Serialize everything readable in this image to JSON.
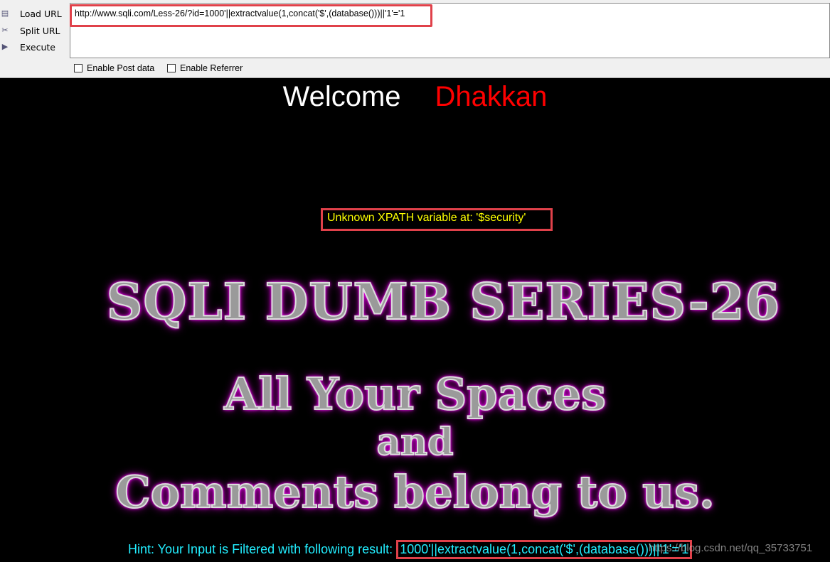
{
  "toolbar": {
    "load_url": "Load URL",
    "split_url": "Split URL",
    "execute": "Execute",
    "url_value": "http://www.sqli.com/Less-26/?id=1000'||extractvalue(1,concat('$',(database()))||'1'='1",
    "enable_post": "Enable Post data",
    "enable_referrer": "Enable Referrer"
  },
  "page": {
    "welcome": "Welcome",
    "name": "Dhakkan",
    "error": "Unknown XPATH variable at: '$security'",
    "title": "SQLI DUMB SERIES-26",
    "line1": "All Your Spaces",
    "line2": "and",
    "line3": "Comments belong to us.",
    "hint_label": "Hint: Your Input is Filtered with following result: ",
    "hint_value": "1000'||extractvalue(1,concat('$',(database()))||'1'='1",
    "watermark": "https://blog.csdn.net/qq_35733751"
  },
  "colors": {
    "highlight": "#e0414a",
    "error": "#ffff00",
    "hint": "#22eeff",
    "name": "#ff0000"
  }
}
